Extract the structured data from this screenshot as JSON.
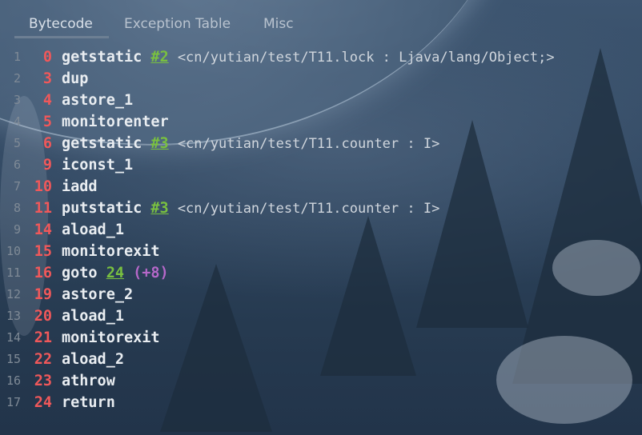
{
  "tabs": [
    {
      "label": "Bytecode",
      "active": true
    },
    {
      "label": "Exception Table",
      "active": false
    },
    {
      "label": "Misc",
      "active": false
    }
  ],
  "colors": {
    "offset": "#f0585a",
    "opcode": "#e9edf1",
    "reference": "#79c040",
    "jump_delta": "#b668c9",
    "line_number": "#7f8a96"
  },
  "code": [
    {
      "line": "1",
      "offset": "0",
      "opcode": "getstatic",
      "ref": "#2",
      "desc": "<cn/yutian/test/T11.lock : Ljava/lang/Object;>"
    },
    {
      "line": "2",
      "offset": "3",
      "opcode": "dup"
    },
    {
      "line": "3",
      "offset": "4",
      "opcode": "astore_1"
    },
    {
      "line": "4",
      "offset": "5",
      "opcode": "monitorenter"
    },
    {
      "line": "5",
      "offset": "6",
      "opcode": "getstatic",
      "ref": "#3",
      "desc": "<cn/yutian/test/T11.counter : I>"
    },
    {
      "line": "6",
      "offset": "9",
      "opcode": "iconst_1"
    },
    {
      "line": "7",
      "offset": "10",
      "opcode": "iadd"
    },
    {
      "line": "8",
      "offset": "11",
      "opcode": "putstatic",
      "ref": "#3",
      "desc": "<cn/yutian/test/T11.counter : I>"
    },
    {
      "line": "9",
      "offset": "14",
      "opcode": "aload_1"
    },
    {
      "line": "10",
      "offset": "15",
      "opcode": "monitorexit"
    },
    {
      "line": "11",
      "offset": "16",
      "opcode": "goto",
      "ref": "24",
      "jump": "(+8)"
    },
    {
      "line": "12",
      "offset": "19",
      "opcode": "astore_2"
    },
    {
      "line": "13",
      "offset": "20",
      "opcode": "aload_1"
    },
    {
      "line": "14",
      "offset": "21",
      "opcode": "monitorexit"
    },
    {
      "line": "15",
      "offset": "22",
      "opcode": "aload_2"
    },
    {
      "line": "16",
      "offset": "23",
      "opcode": "athrow"
    },
    {
      "line": "17",
      "offset": "24",
      "opcode": "return"
    }
  ]
}
